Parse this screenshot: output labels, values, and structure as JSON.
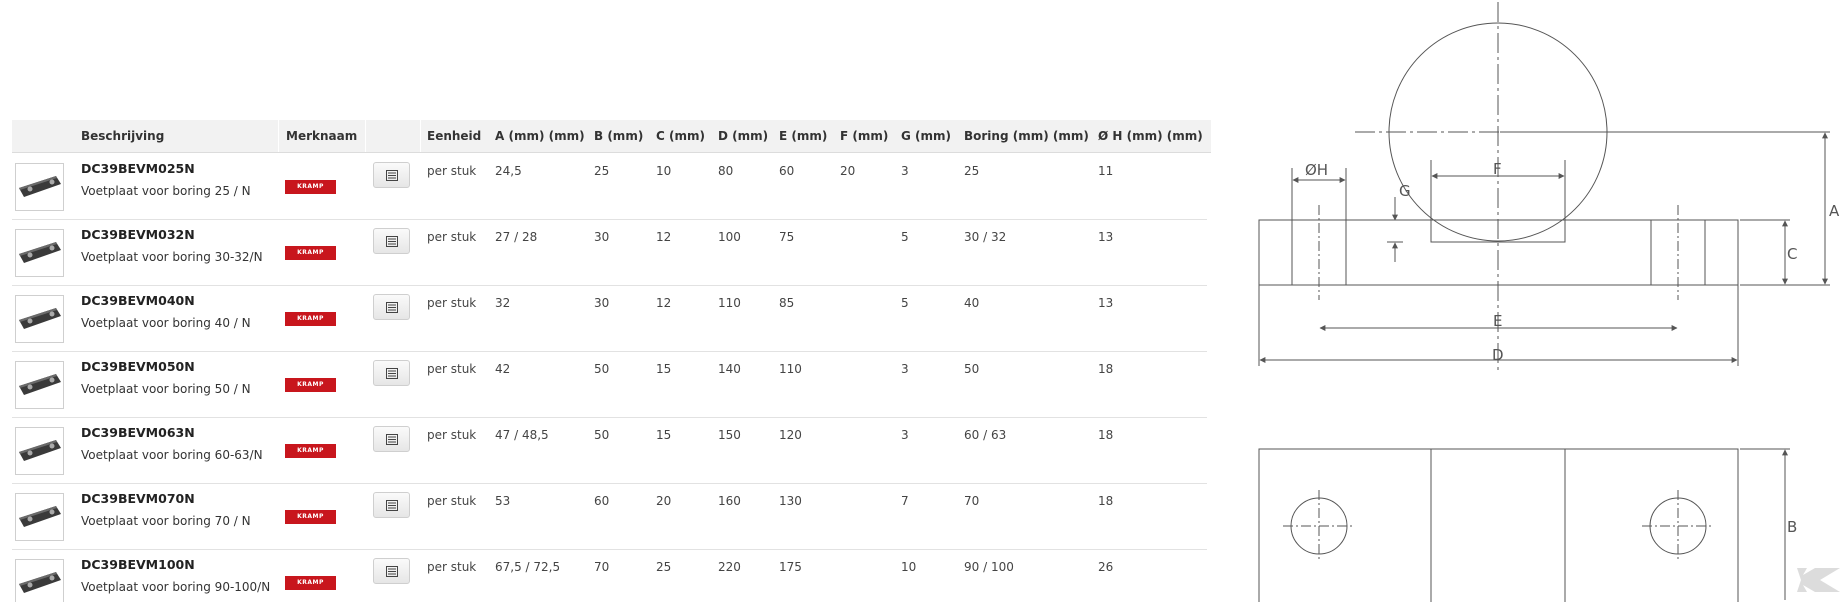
{
  "table": {
    "headers": {
      "beschrijving": "Beschrijving",
      "merknaam": "Merknaam",
      "eenheid": "Eenheid",
      "a": "A (mm) (mm)",
      "b": "B (mm)",
      "c": "C (mm)",
      "d": "D (mm)",
      "e": "E (mm)",
      "f": "F (mm)",
      "g": "G (mm)",
      "boring": "Boring (mm) (mm)",
      "h": "Ø H (mm) (mm)"
    },
    "rows": [
      {
        "code": "DC39BEVM025N",
        "desc": "Voetplaat voor boring 25 / N",
        "brand": "KRAMP",
        "eenheid": "per stuk",
        "a": "24,5",
        "b": "25",
        "c": "10",
        "d": "80",
        "e": "60",
        "f": "20",
        "g": "3",
        "boring": "25",
        "h": "11"
      },
      {
        "code": "DC39BEVM032N",
        "desc": "Voetplaat voor boring 30-32/N",
        "brand": "KRAMP",
        "eenheid": "per stuk",
        "a": "27 / 28",
        "b": "30",
        "c": "12",
        "d": "100",
        "e": "75",
        "f": "",
        "g": "5",
        "boring": "30 / 32",
        "h": "13"
      },
      {
        "code": "DC39BEVM040N",
        "desc": "Voetplaat voor boring 40 / N",
        "brand": "KRAMP",
        "eenheid": "per stuk",
        "a": "32",
        "b": "30",
        "c": "12",
        "d": "110",
        "e": "85",
        "f": "",
        "g": "5",
        "boring": "40",
        "h": "13"
      },
      {
        "code": "DC39BEVM050N",
        "desc": "Voetplaat voor boring 50 / N",
        "brand": "KRAMP",
        "eenheid": "per stuk",
        "a": "42",
        "b": "50",
        "c": "15",
        "d": "140",
        "e": "110",
        "f": "",
        "g": "3",
        "boring": "50",
        "h": "18"
      },
      {
        "code": "DC39BEVM063N",
        "desc": "Voetplaat voor boring 60-63/N",
        "brand": "KRAMP",
        "eenheid": "per stuk",
        "a": "47 / 48,5",
        "b": "50",
        "c": "15",
        "d": "150",
        "e": "120",
        "f": "",
        "g": "3",
        "boring": "60 / 63",
        "h": "18"
      },
      {
        "code": "DC39BEVM070N",
        "desc": "Voetplaat voor boring 70 / N",
        "brand": "KRAMP",
        "eenheid": "per stuk",
        "a": "53",
        "b": "60",
        "c": "20",
        "d": "160",
        "e": "130",
        "f": "",
        "g": "7",
        "boring": "70",
        "h": "18"
      },
      {
        "code": "DC39BEVM100N",
        "desc": "Voetplaat voor boring 90-100/N",
        "brand": "KRAMP",
        "eenheid": "per stuk",
        "a": "67,5 / 72,5",
        "b": "70",
        "c": "25",
        "d": "220",
        "e": "175",
        "f": "",
        "g": "10",
        "boring": "90 / 100",
        "h": "26"
      }
    ]
  },
  "drawing": {
    "labels": {
      "a": "A",
      "b": "B",
      "c": "C",
      "d": "D",
      "e": "E",
      "f": "F",
      "g": "G",
      "h": "ØH"
    }
  },
  "icons": {
    "row_action": "spec-sheet-icon",
    "watermark": "kramp-watermark-logo"
  },
  "colors": {
    "brand_red": "#c8161d",
    "header_bg": "#f2f2f2"
  }
}
